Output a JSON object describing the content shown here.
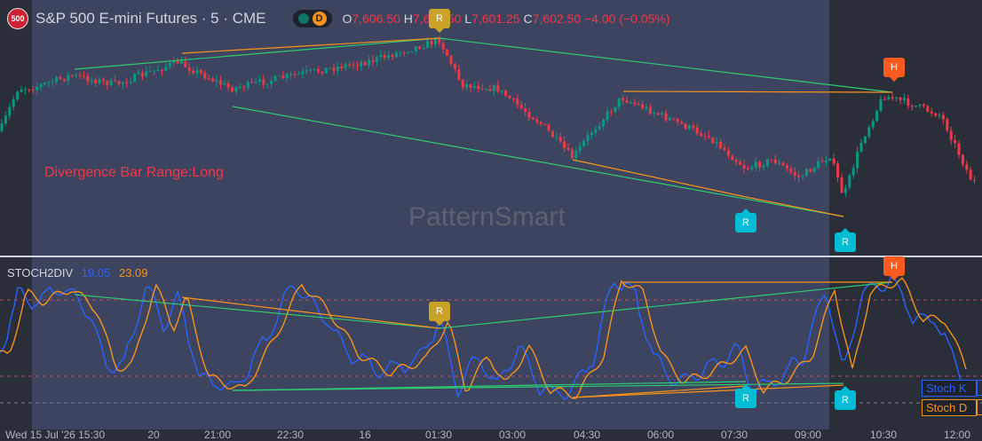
{
  "header": {
    "logo_text": "500",
    "symbol": "S&P 500 E-mini Futures · 5 · CME",
    "badge_letter": "D",
    "open_key": "O",
    "open": "7,606.50",
    "high_key": "H",
    "high": "7,609.50",
    "low_key": "L",
    "low": "7,601.25",
    "close_key": "C",
    "close": "7,602.50",
    "change": "−4.00 (−0.05%)"
  },
  "main_pane": {
    "annotation": "Divergence Bar Range:Long",
    "watermark": "PatternSmart",
    "markers": [
      {
        "label": "R",
        "color": "#c9a227",
        "pos": "top"
      },
      {
        "label": "H",
        "color": "#ff5a1f",
        "pos": "top"
      },
      {
        "label": "R",
        "color": "#00bcd4",
        "pos": "bottom"
      },
      {
        "label": "R",
        "color": "#00bcd4",
        "pos": "bottom"
      }
    ]
  },
  "stoch_pane": {
    "name": "STOCH2DIV",
    "k_value": "19.05",
    "d_value": "23.09",
    "k_tag": "Stoch K",
    "d_tag": "Stoch D",
    "markers": [
      {
        "label": "R",
        "color": "#c9a227"
      },
      {
        "label": "H",
        "color": "#ff5a1f"
      },
      {
        "label": "R",
        "color": "#00bcd4"
      },
      {
        "label": "R",
        "color": "#00bcd4"
      }
    ]
  },
  "time_axis": {
    "first_label": "Wed 15 Jul '26  15:30",
    "ticks": [
      "20",
      "21:00",
      "22:30",
      "16",
      "01:30",
      "03:00",
      "04:30",
      "06:00",
      "07:30",
      "09:00",
      "10:30",
      "12:00"
    ]
  },
  "colors": {
    "bull": "#089981",
    "bear": "#f23645",
    "stoch_k": "#2962ff",
    "stoch_d": "#f7931a",
    "div_green": "#2ecc71",
    "div_orange": "#f7931a",
    "range_shade": "#3d4460"
  }
}
